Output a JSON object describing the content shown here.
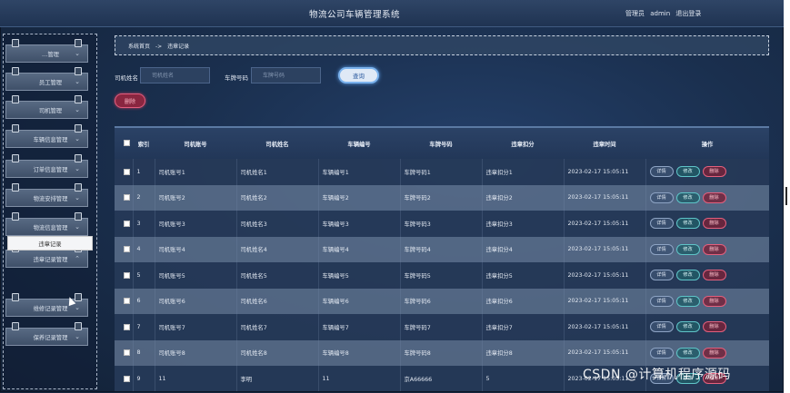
{
  "header": {
    "title": "物流公司车辆管理系统",
    "role": "管理员",
    "username": "admin",
    "logout_label": "退出登录"
  },
  "sidebar": {
    "items": [
      {
        "label": "…管理"
      },
      {
        "label": "员工管理"
      },
      {
        "label": "司机管理"
      },
      {
        "label": "车辆信息管理"
      },
      {
        "label": "订单信息管理"
      },
      {
        "label": "物流安排管理"
      },
      {
        "label": "物流信息管理"
      },
      {
        "label": "违章记录管理"
      },
      {
        "label": "维修记录管理"
      },
      {
        "label": "保养记录管理"
      }
    ],
    "sub_item": "违章记录"
  },
  "breadcrumb": {
    "home": "系统首页",
    "sep": "->",
    "current": "违章记录"
  },
  "search": {
    "driver_name_label": "司机姓名",
    "driver_name_placeholder": "司机姓名",
    "plate_label": "车牌号码",
    "plate_placeholder": "车牌号码",
    "search_button": "查询",
    "delete_button": "删除"
  },
  "table": {
    "headers": [
      "",
      "索引",
      "司机账号",
      "司机姓名",
      "车辆编号",
      "车牌号码",
      "违章扣分",
      "违章时间",
      "操作"
    ],
    "op_labels": {
      "detail": "详情",
      "edit": "修改",
      "delete": "删除"
    },
    "rows": [
      {
        "idx": "1",
        "account": "司机账号1",
        "name": "司机姓名1",
        "vehicle": "车辆编号1",
        "plate": "车牌号码1",
        "points": "违章扣分1",
        "time": "2023-02-17 15:05:11"
      },
      {
        "idx": "2",
        "account": "司机账号2",
        "name": "司机姓名2",
        "vehicle": "车辆编号2",
        "plate": "车牌号码2",
        "points": "违章扣分2",
        "time": "2023-02-17 15:05:11"
      },
      {
        "idx": "3",
        "account": "司机账号3",
        "name": "司机姓名3",
        "vehicle": "车辆编号3",
        "plate": "车牌号码3",
        "points": "违章扣分3",
        "time": "2023-02-17 15:05:11"
      },
      {
        "idx": "4",
        "account": "司机账号4",
        "name": "司机姓名4",
        "vehicle": "车辆编号4",
        "plate": "车牌号码4",
        "points": "违章扣分4",
        "time": "2023-02-17 15:05:11"
      },
      {
        "idx": "5",
        "account": "司机账号5",
        "name": "司机姓名5",
        "vehicle": "车辆编号5",
        "plate": "车牌号码5",
        "points": "违章扣分5",
        "time": "2023-02-17 15:05:11"
      },
      {
        "idx": "6",
        "account": "司机账号6",
        "name": "司机姓名6",
        "vehicle": "车辆编号6",
        "plate": "车牌号码6",
        "points": "违章扣分6",
        "time": "2023-02-17 15:05:11"
      },
      {
        "idx": "7",
        "account": "司机账号7",
        "name": "司机姓名7",
        "vehicle": "车辆编号7",
        "plate": "车牌号码7",
        "points": "违章扣分7",
        "time": "2023-02-17 15:05:11"
      },
      {
        "idx": "8",
        "account": "司机账号8",
        "name": "司机姓名8",
        "vehicle": "车辆编号8",
        "plate": "车牌号码8",
        "points": "违章扣分8",
        "time": "2023-02-17 15:05:11"
      },
      {
        "idx": "9",
        "account": "11",
        "name": "李明",
        "vehicle": "11",
        "plate": "京A66666",
        "points": "5",
        "time": "2023-02-17 15:05:11"
      }
    ]
  },
  "watermark": "CSDN @计算机程序源码"
}
